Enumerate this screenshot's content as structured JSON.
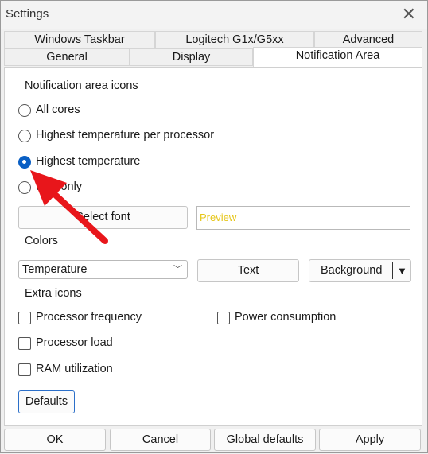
{
  "window": {
    "title": "Settings"
  },
  "tabs": {
    "row1": [
      "Windows Taskbar",
      "Logitech G1x/G5xx",
      "Advanced"
    ],
    "row2": [
      "General",
      "Display",
      "Notification Area"
    ]
  },
  "notification": {
    "group_label": "Notification area icons",
    "options": [
      "All cores",
      "Highest temperature per processor",
      "Highest temperature",
      "Icon only"
    ],
    "selected_index": 2,
    "select_font_label": "Select font",
    "preview_text": "Preview",
    "preview_color": "#e6c619"
  },
  "colors": {
    "label": "Colors",
    "dropdown_value": "Temperature",
    "text_button": "Text",
    "background_button": "Background"
  },
  "extra": {
    "label": "Extra icons",
    "processor_frequency": "Processor frequency",
    "power_consumption": "Power consumption",
    "processor_load": "Processor load",
    "ram_utilization": "RAM utilization"
  },
  "defaults_button": "Defaults",
  "footer": {
    "ok": "OK",
    "cancel": "Cancel",
    "global_defaults": "Global defaults",
    "apply": "Apply"
  },
  "accent_color": "#0a5fc4",
  "annotation_arrow_color": "#e8161b"
}
